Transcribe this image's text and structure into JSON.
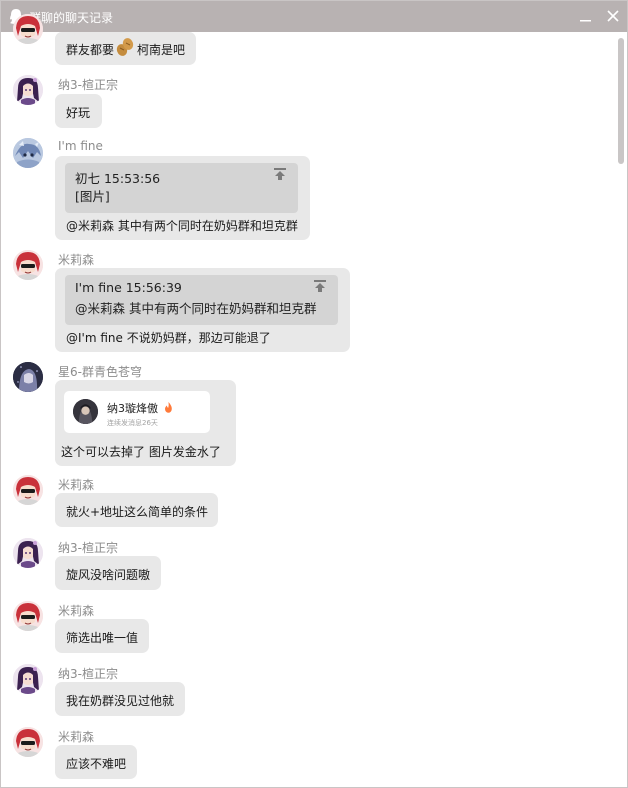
{
  "window": {
    "title": "群聊的聊天记录"
  },
  "messages": [
    {
      "text_before": "群友都要",
      "emoji": "peanut-emoji",
      "text_after": "柯南是吧"
    },
    {
      "sender": "纳3-楦正宗",
      "text": "好玩"
    },
    {
      "sender": "I'm fine",
      "quote": {
        "header": "初七   15:53:56",
        "body": "[图片]"
      },
      "text": "@米莉森 其中有两个同时在奶妈群和坦克群"
    },
    {
      "sender": "米莉森",
      "quote": {
        "header": "I'm fine   15:56:39",
        "body": "@米莉森 其中有两个同时在奶妈群和坦克群"
      },
      "text": "@I'm fine 不说奶妈群，那边可能退了"
    },
    {
      "sender": "星6-群青色苍穹",
      "card": {
        "name": "纳3璇烽傲",
        "badge": "fire-icon",
        "subtitle": "连续发消息26天"
      },
      "text": "这个可以去掉了   图片发金水了"
    },
    {
      "sender": "米莉森",
      "text": "就火+地址这么简单的条件"
    },
    {
      "sender": "纳3-楦正宗",
      "text": "旋风没啥问题嗷"
    },
    {
      "sender": "米莉森",
      "text": "筛选出唯一值"
    },
    {
      "sender": "纳3-楦正宗",
      "text": "我在奶群没见过他就"
    },
    {
      "sender": "米莉森",
      "text": "应该不难吧"
    }
  ],
  "colors": {
    "titlebar": "#b8b2b2",
    "bubble": "#e8e8e8",
    "quote": "#d4d4d4",
    "sender": "#8c8c8c"
  }
}
